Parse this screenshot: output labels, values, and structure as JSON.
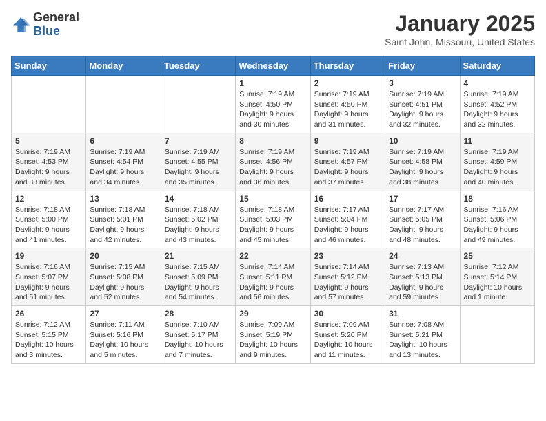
{
  "logo": {
    "general": "General",
    "blue": "Blue"
  },
  "header": {
    "month": "January 2025",
    "location": "Saint John, Missouri, United States"
  },
  "weekdays": [
    "Sunday",
    "Monday",
    "Tuesday",
    "Wednesday",
    "Thursday",
    "Friday",
    "Saturday"
  ],
  "weeks": [
    [
      {
        "day": "",
        "sunrise": "",
        "sunset": "",
        "daylight": ""
      },
      {
        "day": "",
        "sunrise": "",
        "sunset": "",
        "daylight": ""
      },
      {
        "day": "",
        "sunrise": "",
        "sunset": "",
        "daylight": ""
      },
      {
        "day": "1",
        "sunrise": "Sunrise: 7:19 AM",
        "sunset": "Sunset: 4:50 PM",
        "daylight": "Daylight: 9 hours and 30 minutes."
      },
      {
        "day": "2",
        "sunrise": "Sunrise: 7:19 AM",
        "sunset": "Sunset: 4:50 PM",
        "daylight": "Daylight: 9 hours and 31 minutes."
      },
      {
        "day": "3",
        "sunrise": "Sunrise: 7:19 AM",
        "sunset": "Sunset: 4:51 PM",
        "daylight": "Daylight: 9 hours and 32 minutes."
      },
      {
        "day": "4",
        "sunrise": "Sunrise: 7:19 AM",
        "sunset": "Sunset: 4:52 PM",
        "daylight": "Daylight: 9 hours and 32 minutes."
      }
    ],
    [
      {
        "day": "5",
        "sunrise": "Sunrise: 7:19 AM",
        "sunset": "Sunset: 4:53 PM",
        "daylight": "Daylight: 9 hours and 33 minutes."
      },
      {
        "day": "6",
        "sunrise": "Sunrise: 7:19 AM",
        "sunset": "Sunset: 4:54 PM",
        "daylight": "Daylight: 9 hours and 34 minutes."
      },
      {
        "day": "7",
        "sunrise": "Sunrise: 7:19 AM",
        "sunset": "Sunset: 4:55 PM",
        "daylight": "Daylight: 9 hours and 35 minutes."
      },
      {
        "day": "8",
        "sunrise": "Sunrise: 7:19 AM",
        "sunset": "Sunset: 4:56 PM",
        "daylight": "Daylight: 9 hours and 36 minutes."
      },
      {
        "day": "9",
        "sunrise": "Sunrise: 7:19 AM",
        "sunset": "Sunset: 4:57 PM",
        "daylight": "Daylight: 9 hours and 37 minutes."
      },
      {
        "day": "10",
        "sunrise": "Sunrise: 7:19 AM",
        "sunset": "Sunset: 4:58 PM",
        "daylight": "Daylight: 9 hours and 38 minutes."
      },
      {
        "day": "11",
        "sunrise": "Sunrise: 7:19 AM",
        "sunset": "Sunset: 4:59 PM",
        "daylight": "Daylight: 9 hours and 40 minutes."
      }
    ],
    [
      {
        "day": "12",
        "sunrise": "Sunrise: 7:18 AM",
        "sunset": "Sunset: 5:00 PM",
        "daylight": "Daylight: 9 hours and 41 minutes."
      },
      {
        "day": "13",
        "sunrise": "Sunrise: 7:18 AM",
        "sunset": "Sunset: 5:01 PM",
        "daylight": "Daylight: 9 hours and 42 minutes."
      },
      {
        "day": "14",
        "sunrise": "Sunrise: 7:18 AM",
        "sunset": "Sunset: 5:02 PM",
        "daylight": "Daylight: 9 hours and 43 minutes."
      },
      {
        "day": "15",
        "sunrise": "Sunrise: 7:18 AM",
        "sunset": "Sunset: 5:03 PM",
        "daylight": "Daylight: 9 hours and 45 minutes."
      },
      {
        "day": "16",
        "sunrise": "Sunrise: 7:17 AM",
        "sunset": "Sunset: 5:04 PM",
        "daylight": "Daylight: 9 hours and 46 minutes."
      },
      {
        "day": "17",
        "sunrise": "Sunrise: 7:17 AM",
        "sunset": "Sunset: 5:05 PM",
        "daylight": "Daylight: 9 hours and 48 minutes."
      },
      {
        "day": "18",
        "sunrise": "Sunrise: 7:16 AM",
        "sunset": "Sunset: 5:06 PM",
        "daylight": "Daylight: 9 hours and 49 minutes."
      }
    ],
    [
      {
        "day": "19",
        "sunrise": "Sunrise: 7:16 AM",
        "sunset": "Sunset: 5:07 PM",
        "daylight": "Daylight: 9 hours and 51 minutes."
      },
      {
        "day": "20",
        "sunrise": "Sunrise: 7:15 AM",
        "sunset": "Sunset: 5:08 PM",
        "daylight": "Daylight: 9 hours and 52 minutes."
      },
      {
        "day": "21",
        "sunrise": "Sunrise: 7:15 AM",
        "sunset": "Sunset: 5:09 PM",
        "daylight": "Daylight: 9 hours and 54 minutes."
      },
      {
        "day": "22",
        "sunrise": "Sunrise: 7:14 AM",
        "sunset": "Sunset: 5:11 PM",
        "daylight": "Daylight: 9 hours and 56 minutes."
      },
      {
        "day": "23",
        "sunrise": "Sunrise: 7:14 AM",
        "sunset": "Sunset: 5:12 PM",
        "daylight": "Daylight: 9 hours and 57 minutes."
      },
      {
        "day": "24",
        "sunrise": "Sunrise: 7:13 AM",
        "sunset": "Sunset: 5:13 PM",
        "daylight": "Daylight: 9 hours and 59 minutes."
      },
      {
        "day": "25",
        "sunrise": "Sunrise: 7:12 AM",
        "sunset": "Sunset: 5:14 PM",
        "daylight": "Daylight: 10 hours and 1 minute."
      }
    ],
    [
      {
        "day": "26",
        "sunrise": "Sunrise: 7:12 AM",
        "sunset": "Sunset: 5:15 PM",
        "daylight": "Daylight: 10 hours and 3 minutes."
      },
      {
        "day": "27",
        "sunrise": "Sunrise: 7:11 AM",
        "sunset": "Sunset: 5:16 PM",
        "daylight": "Daylight: 10 hours and 5 minutes."
      },
      {
        "day": "28",
        "sunrise": "Sunrise: 7:10 AM",
        "sunset": "Sunset: 5:17 PM",
        "daylight": "Daylight: 10 hours and 7 minutes."
      },
      {
        "day": "29",
        "sunrise": "Sunrise: 7:09 AM",
        "sunset": "Sunset: 5:19 PM",
        "daylight": "Daylight: 10 hours and 9 minutes."
      },
      {
        "day": "30",
        "sunrise": "Sunrise: 7:09 AM",
        "sunset": "Sunset: 5:20 PM",
        "daylight": "Daylight: 10 hours and 11 minutes."
      },
      {
        "day": "31",
        "sunrise": "Sunrise: 7:08 AM",
        "sunset": "Sunset: 5:21 PM",
        "daylight": "Daylight: 10 hours and 13 minutes."
      },
      {
        "day": "",
        "sunrise": "",
        "sunset": "",
        "daylight": ""
      }
    ]
  ]
}
